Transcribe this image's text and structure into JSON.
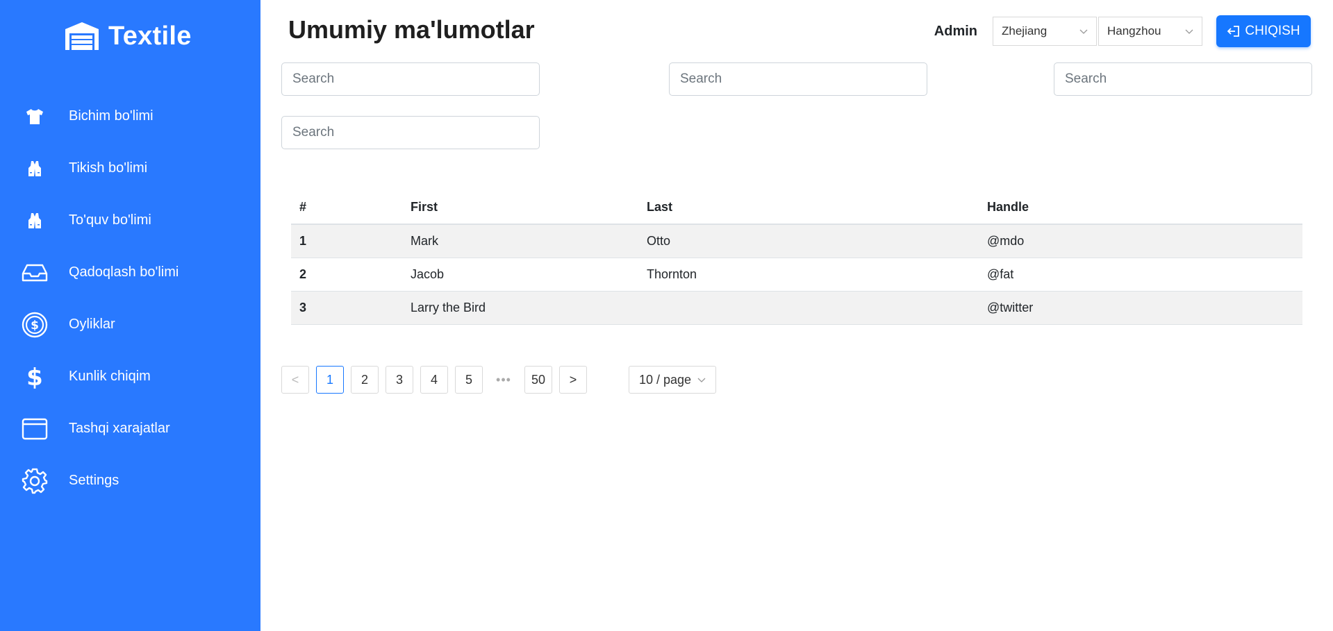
{
  "app": {
    "brand": "Textile"
  },
  "sidebar": {
    "items": [
      {
        "label": "Bichim bo'limi",
        "icon": "tshirt-icon"
      },
      {
        "label": "Tikish bo'limi",
        "icon": "vest-icon"
      },
      {
        "label": "To'quv bo'limi",
        "icon": "vest-icon"
      },
      {
        "label": "Qadoqlash bo'limi",
        "icon": "inbox-icon"
      },
      {
        "label": "Oyliklar",
        "icon": "dollar-circle-icon"
      },
      {
        "label": "Kunlik chiqim",
        "icon": "dollar-icon"
      },
      {
        "label": "Tashqi xarajatlar",
        "icon": "card-icon"
      },
      {
        "label": "Settings",
        "icon": "gear-icon"
      }
    ]
  },
  "header": {
    "title": "Umumiy ma'lumotlar",
    "user": "Admin",
    "province": "Zhejiang",
    "city": "Hangzhou",
    "exit_label": "CHIQISH"
  },
  "search": {
    "placeholder": "Search"
  },
  "table": {
    "columns": [
      "#",
      "First",
      "Last",
      "Handle"
    ],
    "rows": [
      [
        "1",
        "Mark",
        "Otto",
        "@mdo"
      ],
      [
        "2",
        "Jacob",
        "Thornton",
        "@fat"
      ],
      [
        "3",
        "Larry the Bird",
        "",
        "@twitter"
      ]
    ]
  },
  "pagination": {
    "prev": "<",
    "pages": [
      "1",
      "2",
      "3",
      "4",
      "5"
    ],
    "ellipsis": "•••",
    "last": "50",
    "next": ">",
    "current": "1",
    "page_size": "10 / page"
  },
  "colors": {
    "sidebar": "#2979ff",
    "primary": "#1677ff"
  }
}
